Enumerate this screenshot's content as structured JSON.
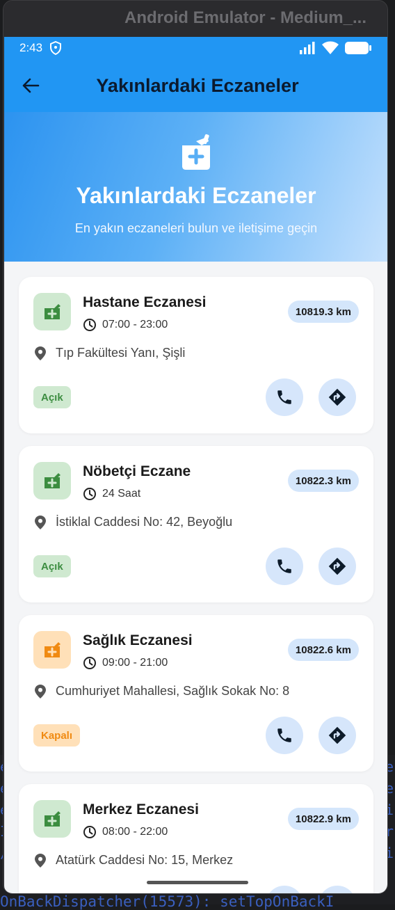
{
  "window": {
    "title": "Android Emulator - Medium_..."
  },
  "statusbar": {
    "time": "2:43"
  },
  "appbar": {
    "title": "Yakınlardaki Eczaneler"
  },
  "hero": {
    "title": "Yakınlardaki Eczaneler",
    "subtitle": "En yakın eczaneleri bulun ve iletişime geçin"
  },
  "colors": {
    "primary": "#2196f3",
    "open_bg": "#cfe9d0",
    "open_text": "#3c8d40",
    "closed_bg": "#ffe0b8",
    "closed_text": "#f08a12"
  },
  "pharmacies": [
    {
      "name": "Hastane Eczanesi",
      "hours": "07:00 - 23:00",
      "distance": "10819.3 km",
      "address": "Tıp Fakültesi Yanı, Şişli",
      "status": "Açık",
      "icon": "pharmacy-green-icon"
    },
    {
      "name": "Nöbetçi Eczane",
      "hours": "24 Saat",
      "distance": "10822.3 km",
      "address": "İstiklal Caddesi No: 42, Beyoğlu",
      "status": "Açık",
      "icon": "pharmacy-green-icon"
    },
    {
      "name": "Sağlık Eczanesi",
      "hours": "09:00 - 21:00",
      "distance": "10822.6 km",
      "address": "Cumhuriyet Mahallesi, Sağlık Sokak No: 8",
      "status": "Kapalı",
      "icon": "pharmacy-orange-icon"
    },
    {
      "name": "Merkez Eczanesi",
      "hours": "08:00 - 22:00",
      "distance": "10822.9 km",
      "address": "Atatürk Caddesi No: 15, Merkez",
      "status": "",
      "icon": "pharmacy-green-icon"
    }
  ],
  "ide": {
    "bottom_line": "OnBackDispatcher(15573): setTopOnBackI"
  }
}
